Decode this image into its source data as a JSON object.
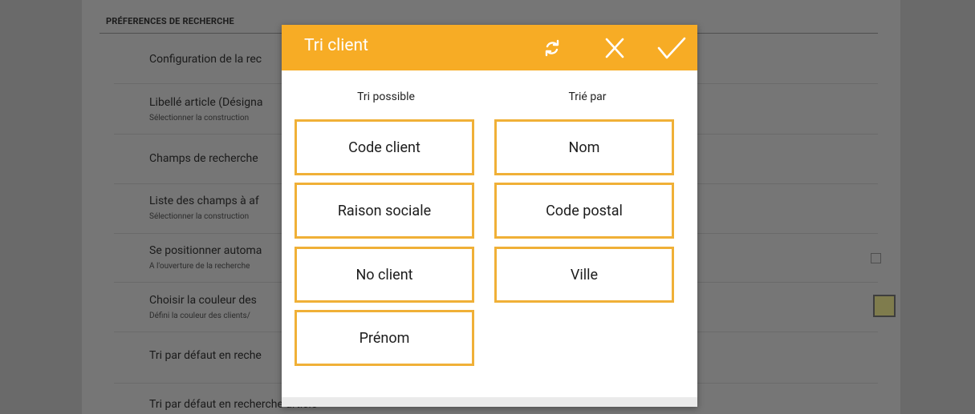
{
  "settings": {
    "section_header": "PRÉFERENCES DE RECHERCHE",
    "rows": [
      {
        "title": "Configuration de la rec",
        "subtitle": ""
      },
      {
        "title": "Libellé article (Désigna",
        "subtitle": "Sélectionner la construction"
      },
      {
        "title": "Champs de recherche",
        "subtitle": ""
      },
      {
        "title": "Liste des champs à af",
        "subtitle": "Sélectionner la construction"
      },
      {
        "title": "Se positionner automa",
        "subtitle": "A l'ouverture de la recherche"
      },
      {
        "title": "Choisir la couleur des",
        "subtitle": "Défini la couleur des clients/"
      },
      {
        "title": "Tri par défaut en reche",
        "subtitle": ""
      },
      {
        "title": "Tri par défaut en recherche article",
        "subtitle": ""
      }
    ],
    "color_swatch": "#7f7c4d"
  },
  "dialog": {
    "title": "Tri client",
    "accent_color": "#f7ac25",
    "icons": [
      "refresh-icon",
      "close-icon",
      "check-icon"
    ],
    "possible_title": "Tri possible",
    "sorted_title": "Trié par",
    "possible": [
      "Code client",
      "Raison sociale",
      "No client",
      "Prénom"
    ],
    "sorted": [
      "Nom",
      "Code postal",
      "Ville"
    ]
  }
}
